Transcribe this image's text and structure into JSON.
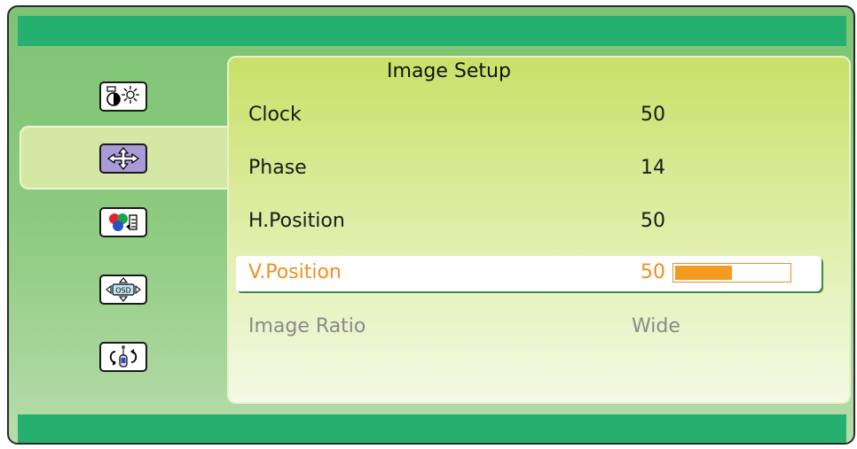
{
  "panel": {
    "title": "Image Setup"
  },
  "sidebar": {
    "items": [
      {
        "icon": "brightness-contrast-icon",
        "selected": false
      },
      {
        "icon": "move-arrows-icon",
        "selected": true
      },
      {
        "icon": "color-adjust-icon",
        "selected": false
      },
      {
        "icon": "osd-position-icon",
        "selected": false
      },
      {
        "icon": "reset-icon",
        "selected": false
      }
    ]
  },
  "menu": {
    "items": [
      {
        "label": "Clock",
        "value": "50"
      },
      {
        "label": "Phase",
        "value": "14"
      },
      {
        "label": "H.Position",
        "value": "50"
      },
      {
        "label": "V.Position",
        "value": "50"
      },
      {
        "label": "Image Ratio",
        "value": "Wide"
      }
    ],
    "selected_index": 3,
    "disabled_index": 4,
    "slider_fraction": 0.5
  },
  "colors": {
    "bar": "#25b06f",
    "highlight": "#f0901e",
    "disabled_text": "#8a8a8a"
  }
}
